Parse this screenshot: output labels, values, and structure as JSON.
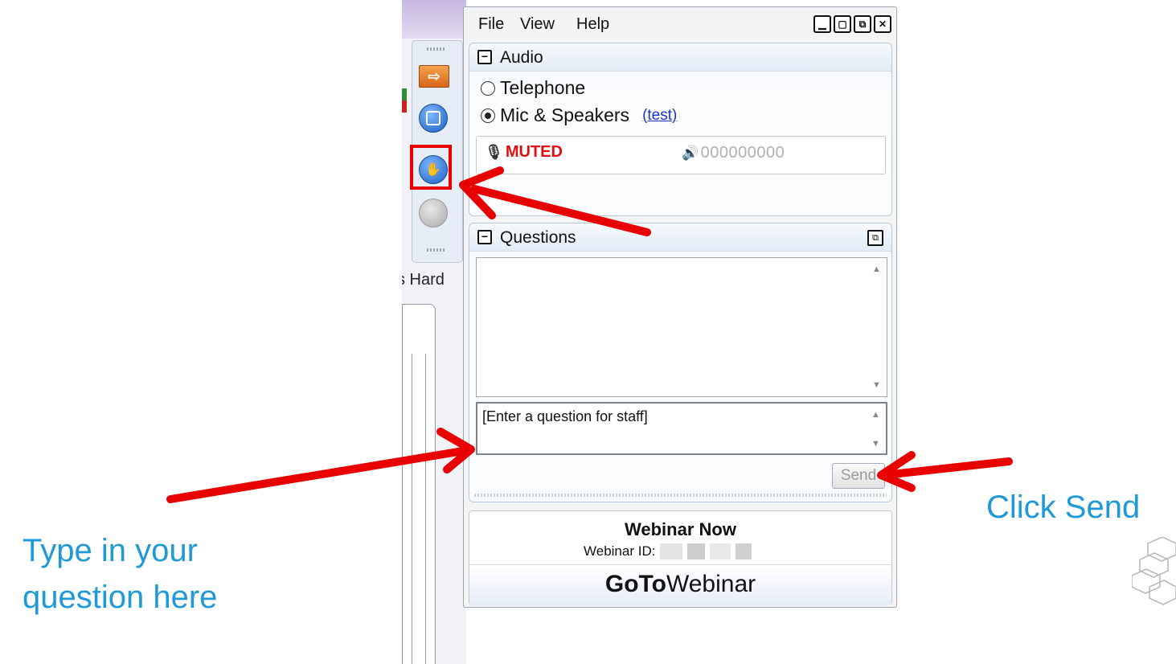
{
  "background_app": {
    "partial_label": "s Hard"
  },
  "menu": {
    "file": "File",
    "view": "View",
    "help": "Help"
  },
  "window_buttons": [
    "minimize",
    "maximize",
    "restore",
    "close"
  ],
  "audio": {
    "title": "Audio",
    "option_telephone": "Telephone",
    "option_mic": "Mic & Speakers",
    "test_link": "(test)",
    "selected": "Mic & Speakers",
    "mute_status": "MUTED",
    "level_meter": "000000000"
  },
  "questions": {
    "title": "Questions",
    "input_placeholder": "[Enter a question for staff]",
    "send_label": "Send"
  },
  "footer": {
    "webinar_title": "Webinar Now",
    "webinar_id_label": "Webinar ID:",
    "brand_bold": "GoTo",
    "brand_regular": "Webinar"
  },
  "annotations": {
    "type_question_line1": "Type in your",
    "type_question_line2": "question here",
    "click_send": "Click Send"
  },
  "colors": {
    "callout_text": "#1f9ad6",
    "arrow": "#e80000",
    "muted": "#dd1111",
    "link": "#1a33cc"
  },
  "icons": {
    "toolbar": [
      "arrow-right-icon",
      "screen-icon",
      "raise-hand-icon",
      "disabled-icon"
    ],
    "audio_bar": [
      "microphone-icon",
      "speaker-icon"
    ]
  }
}
